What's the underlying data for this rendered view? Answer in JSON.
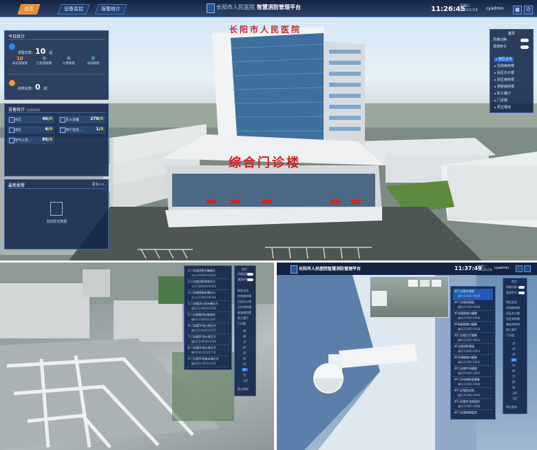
{
  "top": {
    "tabs": [
      "首页",
      "设备监控",
      "报警统计"
    ],
    "title_prefix": "长阳市人民医院",
    "title": "智慧消防管理平台",
    "time": "11:26:45",
    "weekday": "星期三",
    "date": "2022/1/18",
    "user": "cyadmin",
    "today": {
      "title": "今日统计",
      "alarm_label": "报警总数：",
      "alarm_total": "10",
      "alarm_unit": "起",
      "sub": [
        {
          "value": "10",
          "label": "未处理报警",
          "color": "#ff9f2e"
        },
        {
          "value": "0",
          "label": "已处理报警",
          "color": "#2ecfe8"
        },
        {
          "value": "0",
          "label": "火警数据",
          "color": "#2ecfe8"
        },
        {
          "value": "0",
          "label": "误报数据",
          "color": "#2ecfe8"
        }
      ],
      "fault_label": "故障总数：",
      "fault_total": "0",
      "fault_unit": "起"
    },
    "device": {
      "title": "设备统计",
      "title_small": "(在线/离线)",
      "items": [
        {
          "label": "水压",
          "online": "46",
          "offline": "0"
        },
        {
          "label": "灭火设备",
          "online": "278",
          "offline": "0"
        },
        {
          "label": "液位",
          "online": "4",
          "offline": "0"
        },
        {
          "label": "用户信息...",
          "online": "1",
          "offline": "0"
        },
        {
          "label": "电气火灾...",
          "online": "85",
          "offline": "0"
        }
      ]
    },
    "latest": {
      "title": "最新报警",
      "more": "更多>>",
      "empty": "当前暂无数据"
    },
    "building_sign": "综合门诊楼",
    "building_roof": "长阳市人民医院",
    "menu": {
      "head": "首页",
      "toggles": [
        "风格切换",
        "漫游命令"
      ],
      "items": [
        "院区总览",
        "住院病房楼",
        "后区办公楼",
        "后区病房楼",
        "感染病房楼",
        "职工餐厅",
        "门诊楼",
        "周五楼房"
      ]
    }
  },
  "bottom_left": {
    "list": [
      {
        "a": "1.门诊楼消防水箱液位",
        "b": "水位19000316000"
      },
      {
        "a": "2.门诊楼消防泵房压力",
        "b": "水位18000040000"
      },
      {
        "a": "3.门诊楼喷淋末端压力",
        "b": "水位21000316000"
      },
      {
        "a": "4.门诊楼消火栓末端压力",
        "b": "编号21000021266"
      },
      {
        "a": "5.门诊楼屋顶水箱液位",
        "b": "编号21000021267"
      },
      {
        "a": "6.门诊楼1F消火栓压力",
        "b": "编号21000021275"
      },
      {
        "a": "7.门诊楼2F消火栓压力",
        "b": "编号21000021300"
      },
      {
        "a": "8.门诊楼3F消火栓压力",
        "b": "编号62L20101716"
      },
      {
        "a": "9.门诊楼5F喷淋末端压力",
        "b": "编号62L20101654"
      }
    ],
    "menu": {
      "head": "首页",
      "toggles": [
        "风格切换",
        "漫游命令"
      ],
      "items": [
        "院区总览",
        "住院病房楼",
        "后区办公楼",
        "后区病房楼",
        "感染病房楼",
        "职工餐厅",
        "门诊楼"
      ],
      "floors": [
        "9F",
        "8F",
        "7F",
        "6F",
        "5F",
        "4F",
        "3F",
        "2F",
        "1F",
        "11F",
        "12F",
        "13F"
      ],
      "selected_floor": "8F",
      "last": "周五楼房"
    }
  },
  "bottom_right": {
    "title": "长阳市人民医院智慧消防管理平台",
    "time": "11:37:49",
    "weekday": "星期三",
    "date": "2022/1/18",
    "user": "cyadmin",
    "list": [
      {
        "a": "4F门诊楼东通道",
        "b": "编号21965-0906"
      },
      {
        "a": "4F门诊楼西通道",
        "b": "编号21965-0908"
      },
      {
        "a": "4F北面楼梯口摄像",
        "b": "编号21965-0906"
      },
      {
        "a": "4F南面楼梯口摄像",
        "b": "编号21965-0918"
      },
      {
        "a": "4F门诊楼大厅摄像",
        "b": "编号21965-0913"
      },
      {
        "a": "4F北侧消防通道",
        "b": "编号21965-0904"
      },
      {
        "a": "4F东侧楼梯口摄像",
        "b": "编号21965-0902"
      },
      {
        "a": "4F门诊楼中间通道",
        "b": "编号21965-0902"
      },
      {
        "a": "4F门诊电梯前室摄像",
        "b": "编号21965-0906"
      },
      {
        "a": "4F门诊楼西北角",
        "b": "编号21965-0906"
      },
      {
        "a": "4F门诊楼东北角监控",
        "b": "编号21965-0908"
      },
      {
        "a": "4F门诊楼南侧监控",
        "b": "编号21965-0906"
      }
    ],
    "menu": {
      "head": "首页",
      "toggles": [
        "风格切换",
        "漫游命令"
      ],
      "items": [
        "院区总览",
        "住院病房楼",
        "后区办公楼",
        "后区病房楼",
        "感染病房楼",
        "职工餐厅",
        "门诊楼"
      ],
      "floors": [
        "1F",
        "2F",
        "3F",
        "4F",
        "5F",
        "6F",
        "7F",
        "8F",
        "9F",
        "10F",
        "11F",
        "12F"
      ],
      "selected_floor": "4F",
      "last": "周五楼房"
    }
  }
}
